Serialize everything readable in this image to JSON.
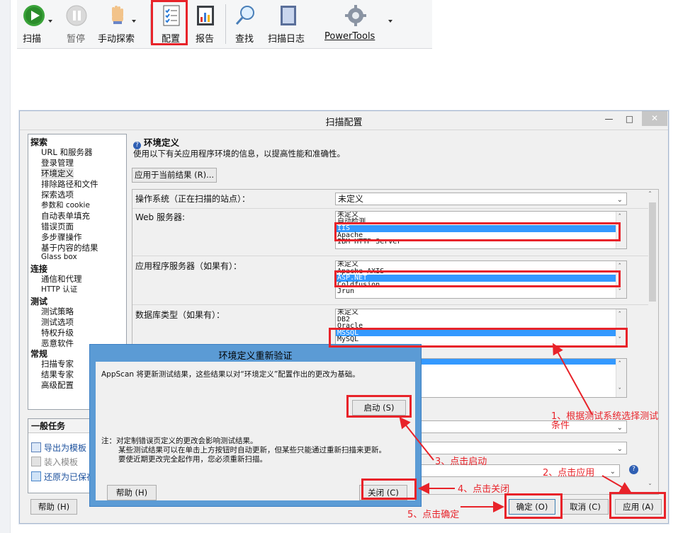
{
  "toolbar": {
    "items": [
      {
        "label": "扫描",
        "icon": "play-icon"
      },
      {
        "label": "暂停",
        "icon": "pause-icon"
      },
      {
        "label": "手动探索",
        "icon": "hand-icon"
      },
      {
        "label": "配置",
        "icon": "config-icon"
      },
      {
        "label": "报告",
        "icon": "report-icon"
      },
      {
        "label": "查找",
        "icon": "search-icon"
      },
      {
        "label": "扫描日志",
        "icon": "log-icon"
      },
      {
        "label": "PowerTools",
        "icon": "gear-icon"
      }
    ]
  },
  "dialog": {
    "title": "扫描配置",
    "nav": {
      "groups": [
        {
          "heading": "探索",
          "items": [
            "URL 和服务器",
            "登录管理",
            "环境定义",
            "排除路径和文件",
            "探索选项",
            "参数和 cookie",
            "自动表单填充",
            "错误页面",
            "多步骤操作",
            "基于内容的结果",
            "Glass box"
          ]
        },
        {
          "heading": "连接",
          "items": [
            "通信和代理",
            "HTTP 认证"
          ]
        },
        {
          "heading": "测试",
          "items": [
            "测试策略",
            "测试选项",
            "特权升级",
            "恶意软件"
          ]
        },
        {
          "heading": "常规",
          "items": [
            "扫描专家",
            "结果专家",
            "高级配置"
          ]
        }
      ],
      "selected": "环境定义"
    },
    "general_tasks": {
      "heading": "一般任务",
      "items": [
        "导出为模板",
        "装入模板",
        "还原为已保存"
      ]
    },
    "section_title": "环境定义",
    "section_desc": "使用以下有关应用程序环境的信息，以提高性能和准确性。",
    "apply_current_button": "应用于当前结果 (R)...",
    "os_label": "操作系统（正在扫描的站点）：",
    "os_value": "未定义",
    "web_server_label": "Web 服务器:",
    "web_server_items": [
      "未定义",
      "自动检测",
      "IIS",
      "Apache",
      "IBM HTTP Server"
    ],
    "web_server_selected": "IIS",
    "app_server_label": "应用程序服务器（如果有）：",
    "app_server_items": [
      "未定义",
      "Apache AXIS",
      "ASP.NET",
      "Coldfusion",
      "Jrun"
    ],
    "app_server_selected": "ASP.NET",
    "db_label": "数据库类型（如果有）：",
    "db_items": [
      "未定义",
      "DB2",
      "Oracle",
      "MSSQL",
      "MySQL"
    ],
    "db_selected": "MSSQL",
    "help_button": "帮助 (H)",
    "ok_button": "确定 (O)",
    "cancel_button": "取消 (C)",
    "apply_button": "应用 (A)"
  },
  "modal": {
    "title": "环境定义重新验证",
    "message": "AppScan 将更新测试结果，这些结果以对“环境定义”配置作出的更改为基础。",
    "start_button": "启动 (S)",
    "note_line1": "注：对定制错误页定义的更改会影响测试结果。",
    "note_line2": "某些测试结果可以在单击上方按钮时自动更新，但某些只能通过重新扫描来更新。",
    "note_line3": "要使近期更改完全起作用，您必须重新扫描。",
    "help_button": "帮助 (H)",
    "close_button": "关闭 (C)"
  },
  "annotations": {
    "step1_line1": "1、根据测试系统选择测试",
    "step1_line2": "条件",
    "step2": "2、点击应用",
    "step3": "3、点击启动",
    "step4": "4、点击关闭",
    "step5": "5、点击确定"
  },
  "colors": {
    "annotation": "#e8232a",
    "selection": "#3399ff",
    "modal_frame": "#5b9bd5"
  }
}
